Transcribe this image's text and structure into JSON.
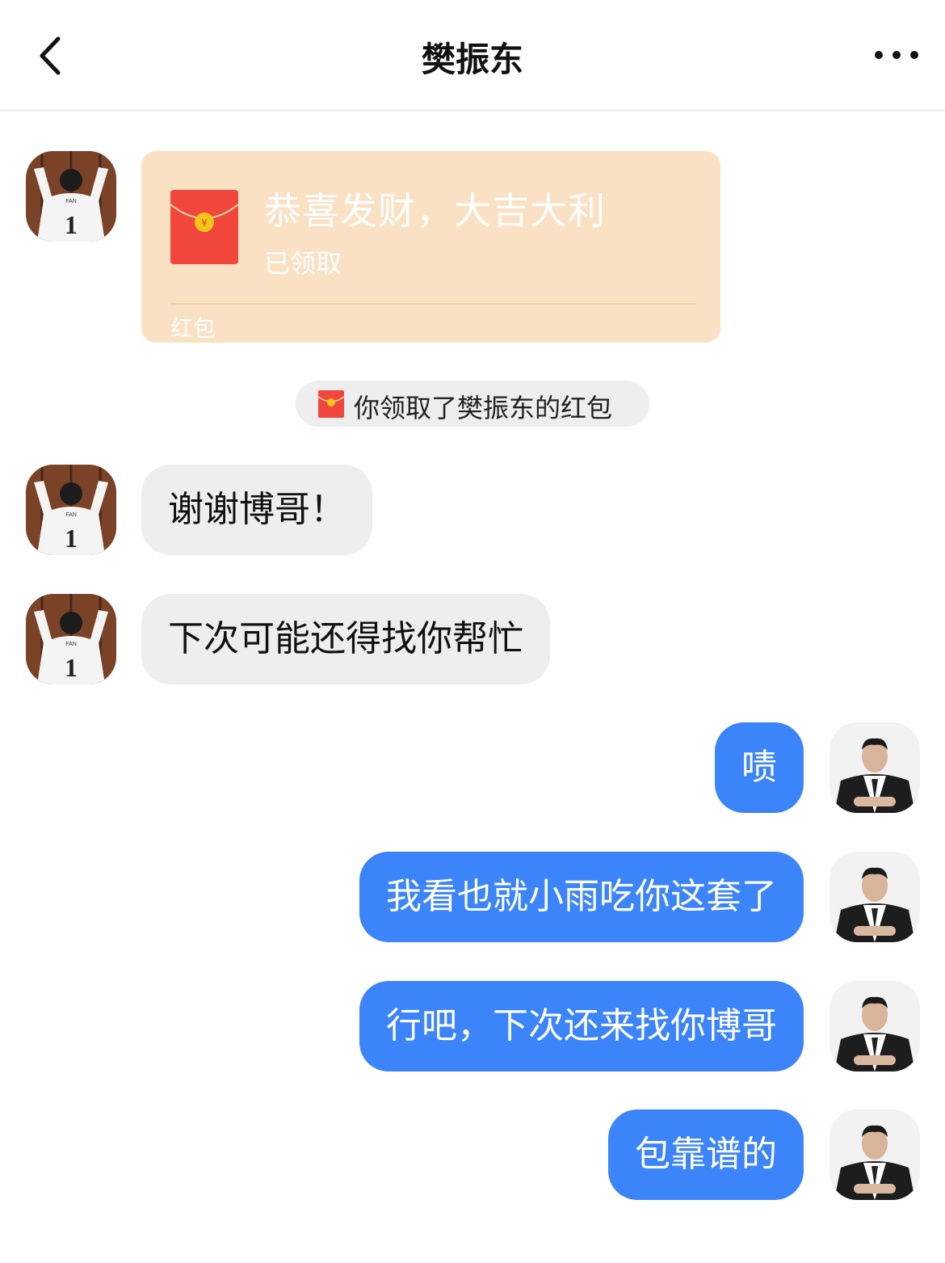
{
  "header": {
    "title": "樊振东",
    "back_icon": "chevron-left-icon",
    "more_icon": "more-horizontal-icon"
  },
  "red_packet": {
    "greeting": "恭喜发财，大吉大利",
    "status": "已领取",
    "label": "红包",
    "colors": {
      "card": "#fbe1c3",
      "envelope": "#f0463c",
      "seal": "#f5c518"
    }
  },
  "system_notice": {
    "text": "你领取了樊振东的红包",
    "icon": "red-envelope-icon"
  },
  "messages": {
    "incoming": [
      {
        "text": "谢谢博哥！"
      },
      {
        "text": "下次可能还得找你帮忙"
      }
    ],
    "outgoing": [
      {
        "text": "啧"
      },
      {
        "text": "我看也就小雨吃你这套了"
      },
      {
        "text": "行吧，下次还来找你博哥"
      },
      {
        "text": "包靠谱的"
      }
    ]
  },
  "colors": {
    "outgoing_bubble": "#3b84f9",
    "incoming_bubble": "#eeeeee",
    "notice_bg": "#eeeeee"
  },
  "avatars": {
    "contact_jersey_text": "FAN",
    "contact_jersey_number": "1"
  }
}
